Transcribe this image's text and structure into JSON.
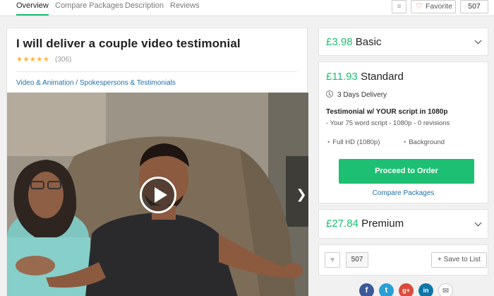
{
  "tabs": [
    {
      "label": "Overview"
    },
    {
      "label": "Compare Packages"
    },
    {
      "label": "Description"
    },
    {
      "label": "Reviews"
    }
  ],
  "header_actions": {
    "menu_icon": "≡",
    "favorite_label": "Favorite",
    "favorite_count": "507"
  },
  "gig": {
    "title": "I will deliver a couple video testimonial",
    "stars": "★★★★★",
    "rating_count": "(306)",
    "breadcrumb": "Video & Animation / Spokespersons & Testimonials"
  },
  "packages": {
    "basic": {
      "price": "£3.98",
      "name": "Basic"
    },
    "standard": {
      "price": "£11.93",
      "name": "Standard",
      "delivery": "3 Days Delivery",
      "title": "Testimonial w/ YOUR script in 1080p",
      "description": "- Your 75 word script - 1080p - 0 revisions",
      "features": [
        "Full HD (1080p)",
        "Background"
      ],
      "order_button": "Proceed to Order",
      "compare_link": "Compare Packages"
    },
    "premium": {
      "price": "£27.84",
      "name": "Premium"
    }
  },
  "like_count": "507",
  "save_to_list": "Save to List",
  "social": [
    {
      "name": "facebook",
      "glyph": "f",
      "color": "#3b5998"
    },
    {
      "name": "twitter",
      "glyph": "t",
      "color": "#2a9fd6"
    },
    {
      "name": "google-plus",
      "glyph": "g+",
      "color": "#dc4a38"
    },
    {
      "name": "linkedin",
      "glyph": "in",
      "color": "#0e76a8"
    },
    {
      "name": "email",
      "glyph": "✉",
      "color": "#ffffff"
    }
  ],
  "colors": {
    "accent": "#1dbf73",
    "link": "#2470a8",
    "star": "#ffb33e"
  }
}
